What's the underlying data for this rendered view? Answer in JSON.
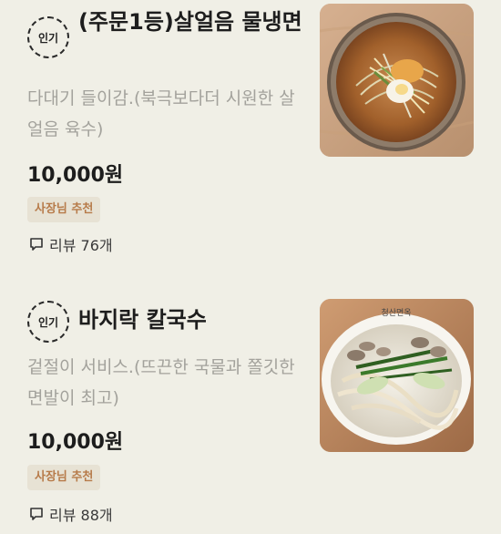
{
  "menu_items": [
    {
      "badge": "인기",
      "title": "(주문1등)살얼음 물냉면",
      "description": "다대기 들이감.(북극보다더 시원한 살얼음 육수)",
      "price": "10,000원",
      "recommendation": "사장님 추천",
      "reviews": "리뷰 76개",
      "image": "cold-noodle-photo"
    },
    {
      "badge": "인기",
      "title": "바지락 칼국수",
      "description": "겉절이 서비스.(뜨끈한 국물과 쫄깃한 면발이 최고)",
      "price": "10,000원",
      "recommendation": "사장님 추천",
      "reviews": "리뷰 88개",
      "image": "clam-kalguksu-photo",
      "image_text": "청산면옥"
    }
  ],
  "colors": {
    "background": "#f0efe6",
    "title": "#1d1d1d",
    "description": "#a3a29c",
    "recommend_text": "#b77b4a",
    "recommend_bg": "#e7e2d4"
  },
  "icons": {
    "review": "speech-bubble-icon",
    "popular_badge": "dashed-circle-badge"
  }
}
